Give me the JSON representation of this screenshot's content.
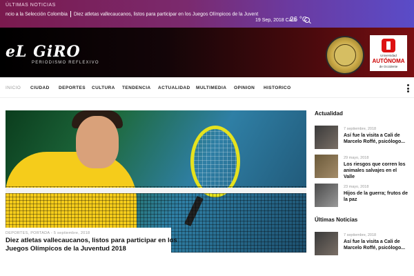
{
  "topbar": {
    "ticker_title": "ÚLTIMAS NOTICIAS",
    "ticker_left": "ncio a la Selección Colombia",
    "ticker_right": "Diez atletas vallecaucanos, listos para participar en los Juegos Olímpicos de la Juvent",
    "date": "19 Sep, 2018 CALI",
    "temperature": "26 °C",
    "icons": [
      "search-icon"
    ]
  },
  "header": {
    "logo": "eL GiRO",
    "slogan": "PERIODISMO REFLEXIVO",
    "seal_text": "ACREDITACIÓN INSTITUCIONAL ALTA CALIDAD",
    "uao": {
      "line1": "Universidad",
      "line2": "AUTÓNOMA",
      "line3": "de Occidente"
    }
  },
  "nav": {
    "items": [
      "INICIO",
      "CIUDAD",
      "DEPORTES",
      "CULTURA",
      "TENDENCIA",
      "ACTUALIDAD",
      "MULTIMEDIA",
      "OPINION",
      "HISTORICO"
    ],
    "active_index": 0
  },
  "hero": {
    "meta": "DEPORTES, PORTADA  -  5 septiembre, 2018",
    "title": "Diez atletas vallecaucanos, listos para participar en los Juegos Olímpicos de la Juventud 2018"
  },
  "sidebar": {
    "actualidad_heading": "Actualidad",
    "actualidad": [
      {
        "date": "7 septiembre, 2018",
        "title": "Así fue la visita a Cali de Marcelo Roffé, psicólogo..."
      },
      {
        "date": "29 mayo, 2018",
        "title": "Los riesgos que corren los animales salvajes en el Valle"
      },
      {
        "date": "23 mayo, 2018",
        "title": "Hijos de la guerra; frutos de la paz"
      }
    ],
    "ultimas_heading": "Últimas Noticias",
    "ultimas": [
      {
        "date": "7 septiembre, 2018",
        "title": "Así fue la visita a Cali de Marcelo Roffé, psicólogo..."
      }
    ]
  },
  "colors": {
    "topbar_start": "#7a1a4e",
    "topbar_end": "#5a4cc8",
    "header_end": "#7a0f12",
    "accent_yellow": "#f5cc1b"
  }
}
